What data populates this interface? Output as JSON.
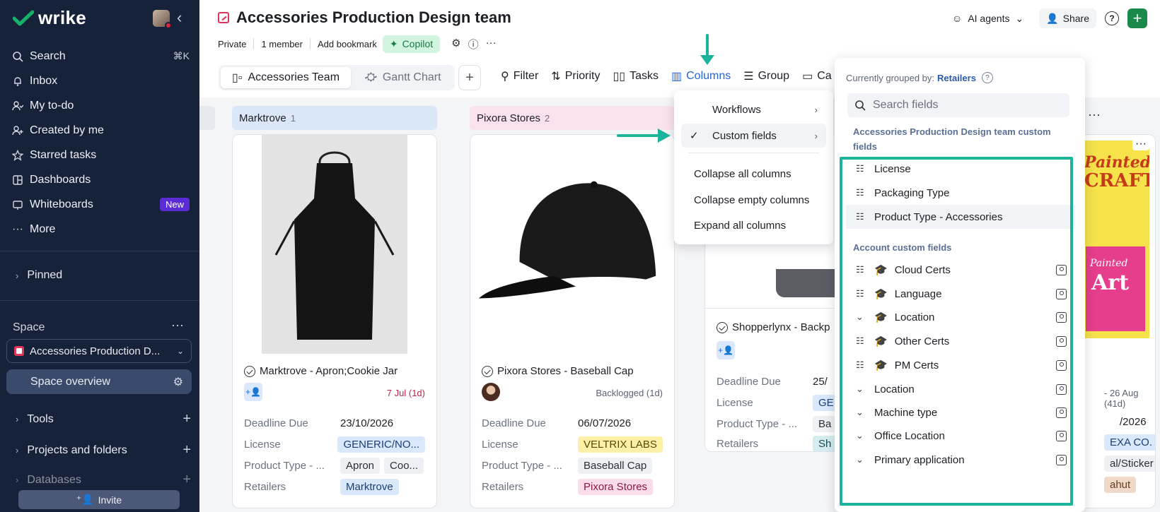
{
  "brand": "wrike",
  "sidebar": {
    "search": {
      "label": "Search",
      "shortcut": "⌘K"
    },
    "items": [
      {
        "label": "Inbox",
        "icon": "bell-icon"
      },
      {
        "label": "My to-do",
        "icon": "person-check-icon"
      },
      {
        "label": "Created by me",
        "icon": "person-plus-icon"
      },
      {
        "label": "Starred tasks",
        "icon": "star-icon"
      },
      {
        "label": "Dashboards",
        "icon": "dashboard-icon"
      },
      {
        "label": "Whiteboards",
        "icon": "whiteboard-icon",
        "badge": "New"
      },
      {
        "label": "More",
        "icon": "dots-icon"
      }
    ],
    "pinned": "Pinned",
    "space_label": "Space",
    "space_name": "Accessories Production D...",
    "space_overview": "Space overview",
    "tools": "Tools",
    "projects": "Projects and folders",
    "databases": "Databases",
    "invite": "Invite"
  },
  "header": {
    "title": "Accessories Production Design team",
    "ai_agents": "AI agents",
    "share": "Share",
    "meta": {
      "private": "Private",
      "members": "1 member",
      "bookmark": "Add bookmark",
      "copilot": "Copilot"
    }
  },
  "views": {
    "tab1": "Accessories Team",
    "tab2": "Gantt Chart"
  },
  "toolbar": {
    "filter": "Filter",
    "priority": "Priority",
    "tasks": "Tasks",
    "columns": "Columns",
    "group": "Group",
    "cut": "Ca"
  },
  "columns_menu": {
    "workflows": "Workflows",
    "custom_fields": "Custom fields",
    "collapse_all": "Collapse all columns",
    "collapse_empty": "Collapse empty columns",
    "expand_all": "Expand all columns"
  },
  "panel": {
    "grouped_prefix": "Currently grouped by:",
    "grouped_value": "Retailers",
    "search_placeholder": "Search fields",
    "section1": "Accessories Production Design team custom fields",
    "section1_fields": [
      "License",
      "Packaging Type",
      "Product Type - Accessories"
    ],
    "section2": "Account custom fields",
    "section2_fields": [
      {
        "label": "Cloud Certs",
        "cap": true,
        "type": "list"
      },
      {
        "label": "Language",
        "cap": true,
        "type": "list"
      },
      {
        "label": "Location",
        "cap": true,
        "type": "dropdown"
      },
      {
        "label": "Other Certs",
        "cap": true,
        "type": "list"
      },
      {
        "label": "PM Certs",
        "cap": true,
        "type": "list"
      },
      {
        "label": "Location",
        "cap": false,
        "type": "dropdown"
      },
      {
        "label": "Machine type",
        "cap": false,
        "type": "dropdown"
      },
      {
        "label": "Office Location",
        "cap": false,
        "type": "dropdown"
      },
      {
        "label": "Primary application",
        "cap": false,
        "type": "dropdown"
      }
    ]
  },
  "board": {
    "col1": {
      "name": "Marktrove",
      "count": "1"
    },
    "col2": {
      "name": "Pixora Stores",
      "count": "2"
    },
    "card1": {
      "title": "Marktrove - Apron;Cookie Jar",
      "date": "7 Jul (1d)",
      "deadline_label": "Deadline Due",
      "deadline": "23/10/2026",
      "license_label": "License",
      "license": "GENERIC/NO...",
      "ptype_label": "Product Type - ...",
      "ptype1": "Apron",
      "ptype2": "Coo...",
      "retailers_label": "Retailers",
      "retailer": "Marktrove"
    },
    "card2": {
      "title": "Pixora Stores - Baseball Cap",
      "status": "Backlogged (1d)",
      "deadline_label": "Deadline Due",
      "deadline": "06/07/2026",
      "license_label": "License",
      "license": "VELTRIX LABS",
      "ptype_label": "Product Type - ...",
      "ptype1": "Baseball Cap",
      "retailers_label": "Retailers",
      "retailer": "Pixora Stores"
    },
    "card3": {
      "title": "Shopperlynx - Backp",
      "deadline_label": "Deadline Due",
      "deadline": "25/",
      "license_label": "License",
      "license": "GE",
      "ptype_label": "Product Type - ...",
      "ptype1": "Ba",
      "retailers_label": "Retailers",
      "retailer": "Sh"
    },
    "card4": {
      "date": "- 26 Aug (41d)",
      "deadline": "/2026",
      "license": "EXA CO.",
      "ptype": "al/Sticker",
      "retailer": "ahut",
      "img_text1": "Painted",
      "img_text2": "CRAFTS",
      "img_text3": "Painted",
      "img_text4": "Art"
    }
  },
  "colors": {
    "accent": "#2466d6",
    "highlight": "#1bb49a",
    "sidebar": "#16213a"
  }
}
